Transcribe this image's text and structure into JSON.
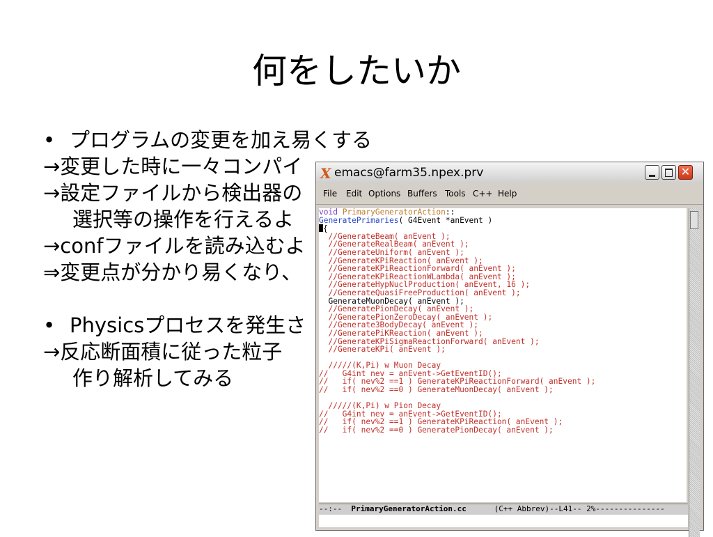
{
  "slide": {
    "title": "何をしたいか",
    "bullets": [
      "プログラムの変更を加え易くする",
      "Physicsプロセスを発生さ"
    ],
    "lines": [
      "→変更した時に一々コンパイ",
      "→設定ファイルから検出器の",
      "選択等の操作を行えるよ",
      "→confファイルを読み込むよ",
      "⇒変更点が分かり易くなり、",
      "→反応断面積に従った粒子",
      "作り解析してみる"
    ],
    "bullet_symbol": "•"
  },
  "window": {
    "title": "emacs@farm35.npex.prv",
    "menu": [
      "File",
      "Edit",
      "Options",
      "Buffers",
      "Tools",
      "C++",
      "Help"
    ],
    "code": [
      [
        "void",
        "PrimaryGeneratorAction",
        "::"
      ],
      [
        "GeneratePrimaries",
        "( G4Event *anEvent )"
      ],
      "{",
      "  //GenerateBeam( anEvent );",
      "  //GenerateRealBeam( anEvent );",
      "  //GenerateUniform( anEvent );",
      "  //GenerateKPiReaction( anEvent );",
      "  //GenerateKPiReactionForward( anEvent );",
      "  //GenerateKPiReactionWLambda( anEvent );",
      "  //GenerateHypNuclProduction( anEvent, 16 );",
      "  //GenerateQuasiFreeProduction( anEvent );",
      "  GenerateMuonDecay( anEvent );",
      "  //GeneratePionDecay( anEvent );",
      "  //GeneratePionZeroDecay( anEvent );",
      "  //Generate3BodyDecay( anEvent );",
      "  //GeneratePiKReaction( anEvent );",
      "  //GenerateKPiSigmaReactionForward( anEvent );",
      "  //GenerateKPi( anEvent );",
      "",
      "  /////(K,Pi) w Muon Decay",
      "//   G4int nev = anEvent->GetEventID();",
      "//   if( nev%2 ==1 ) GenerateKPiReactionForward( anEvent );",
      "//   if( nev%2 ==0 ) GenerateMuonDecay( anEvent );",
      "",
      "  /////(K,Pi) w Pion Decay",
      "//   G4int nev = anEvent->GetEventID();",
      "//   if( nev%2 ==1 ) GenerateKPiReaction( anEvent );",
      "//   if( nev%2 ==0 ) GeneratePionDecay( anEvent );"
    ],
    "modeline_prefix": "--:--  ",
    "modeline_buffer": "PrimaryGeneratorAction.cc",
    "modeline_suffix": "      (C++ Abbrev)--L41-- 2%---------------",
    "colors": {
      "keyword": "#7a3cc8",
      "function": "#2a49c8",
      "comment": "#c0302a",
      "close_button": "#c8381a"
    }
  }
}
